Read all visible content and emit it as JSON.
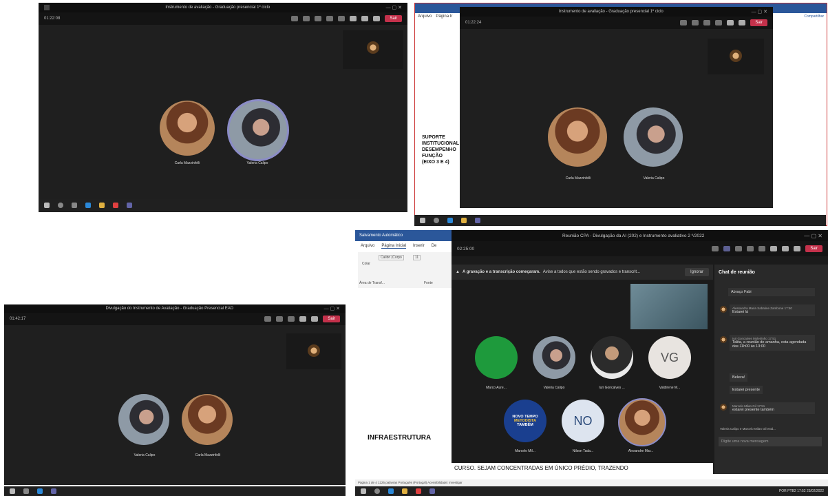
{
  "win1": {
    "title": "Instrumento de avaliação - Graduação presencial 1º ciclo",
    "timer": "01:22:08",
    "leave": "Sair",
    "p1": "Carla Mazzinfelli",
    "p2": "Valeria Calipo"
  },
  "win2": {
    "title": "Instrumento de avaliação - Graduação presencial 1º ciclo",
    "timer": "01:22:24",
    "leave": "Sair",
    "p1": "Carla Mazzinfelli",
    "p2": "Valeria Calipo",
    "word_tabs": [
      "Arquivo",
      "Página Ir"
    ],
    "word_text": [
      "SUPORTE",
      "INSTITUCIONAL",
      "DESEMPENHO",
      "FUNÇÃO",
      "(EIXO 3 E 4)"
    ],
    "right_panel": "Compartilhar"
  },
  "win3": {
    "title": "Divulgação do Instrumento de Avaliação - Graduação Presencial EAD",
    "timer": "01:42:17",
    "leave": "Sair",
    "p1": "Valeria Calipo",
    "p2": "Carla Mazzinfelli"
  },
  "win4": {
    "word_autosave": "Salvamento Automático",
    "word_tabs": [
      "Arquivo",
      "Página Inicial",
      "Inserir",
      "De"
    ],
    "word_font": "Calibri (Corpo",
    "word_size": "11",
    "paste": "Colar",
    "clipboard": "Área de Transf...",
    "font_group": "Fonte",
    "infra": "INFRAESTRUTURA",
    "status_left": "Página 1 de 4   1225 palavras   Português (Portugal)   Acessibilidade: investigar",
    "title": "Reunião CPA - Divulgação da AI (202) e Instrumento avaliativo 2 º/2022",
    "timer": "02:25:00",
    "leave": "Sair",
    "banner_bold": "A gravação e a transcrição começaram.",
    "banner_text": "Avise a todos que estão sendo gravados e transcrit...",
    "banner_btn": "Ignorar",
    "participants": [
      {
        "name": "Marco Aure..."
      },
      {
        "name": "Valeria Calipo"
      },
      {
        "name": "Iuri Goncalves ..."
      },
      {
        "name": "Valdirene M...",
        "initials": "VG"
      },
      {
        "name": "Marcelo Mil..."
      },
      {
        "name": "Nilson Tada...",
        "initials": "NO"
      },
      {
        "name": "Alexandre Mar..."
      }
    ],
    "logo_lines": [
      "NOVO TEMPO",
      "METODISTA",
      "TAMBÉM"
    ],
    "caption": "CURSO. SEJAM CONCENTRADAS EM ÚNICO PRÉDIO, TRAZENDO",
    "chat": {
      "title": "Chat de reunião",
      "m0": "Abraço Fabi",
      "m1_name": "Alessandra Maria Sabatine Zambone",
      "m1_time": "17:50",
      "m1_text": "Estarei lá",
      "m2_name": "Iuri Goncalves Moleirinho",
      "m2_time": "17:51",
      "m2_text": "Talita, a reunião de amanha, esta agendada das 11h00 às 13:00",
      "m2_r1": "Beleza!",
      "m2_r2": "Estarei presente",
      "m3_name": "Marcelo Milan Gil",
      "m3_time": "17:51",
      "m3_text": "estarei presente também",
      "typing": "Valeria Calipo e Marcelo Milan Gil está...",
      "input_placeholder": "Digite uma nova mensagem"
    },
    "clock_lang": "POR PTB2",
    "clock_time": "17:52",
    "clock_date": "23/02/2022"
  }
}
